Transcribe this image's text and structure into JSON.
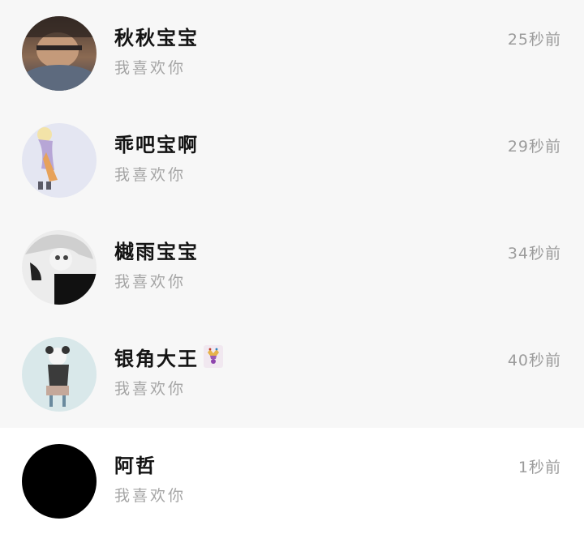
{
  "conversations": [
    {
      "name": "秋秋宝宝",
      "message": "我喜欢你",
      "time": "25秒前",
      "avatar": "photo-avatar-icon",
      "background": "#f7f7f7"
    },
    {
      "name": "乖吧宝啊",
      "message": "我喜欢你",
      "time": "29秒前",
      "avatar": "anime-girl-avatar-icon",
      "background": "#f7f7f7"
    },
    {
      "name": "樾雨宝宝",
      "message": "我喜欢你",
      "time": "34秒前",
      "avatar": "anime-monochrome-avatar-icon",
      "background": "#f7f7f7"
    },
    {
      "name": "银角大王",
      "message": "我喜欢你",
      "time": "40秒前",
      "avatar": "anime-panda-avatar-icon",
      "badge": "jester-badge-icon",
      "background": "#f7f7f7"
    },
    {
      "name": "阿哲",
      "message": "我喜欢你",
      "time": "1秒前",
      "avatar": "black-avatar-icon",
      "background": "#ffffff"
    }
  ]
}
